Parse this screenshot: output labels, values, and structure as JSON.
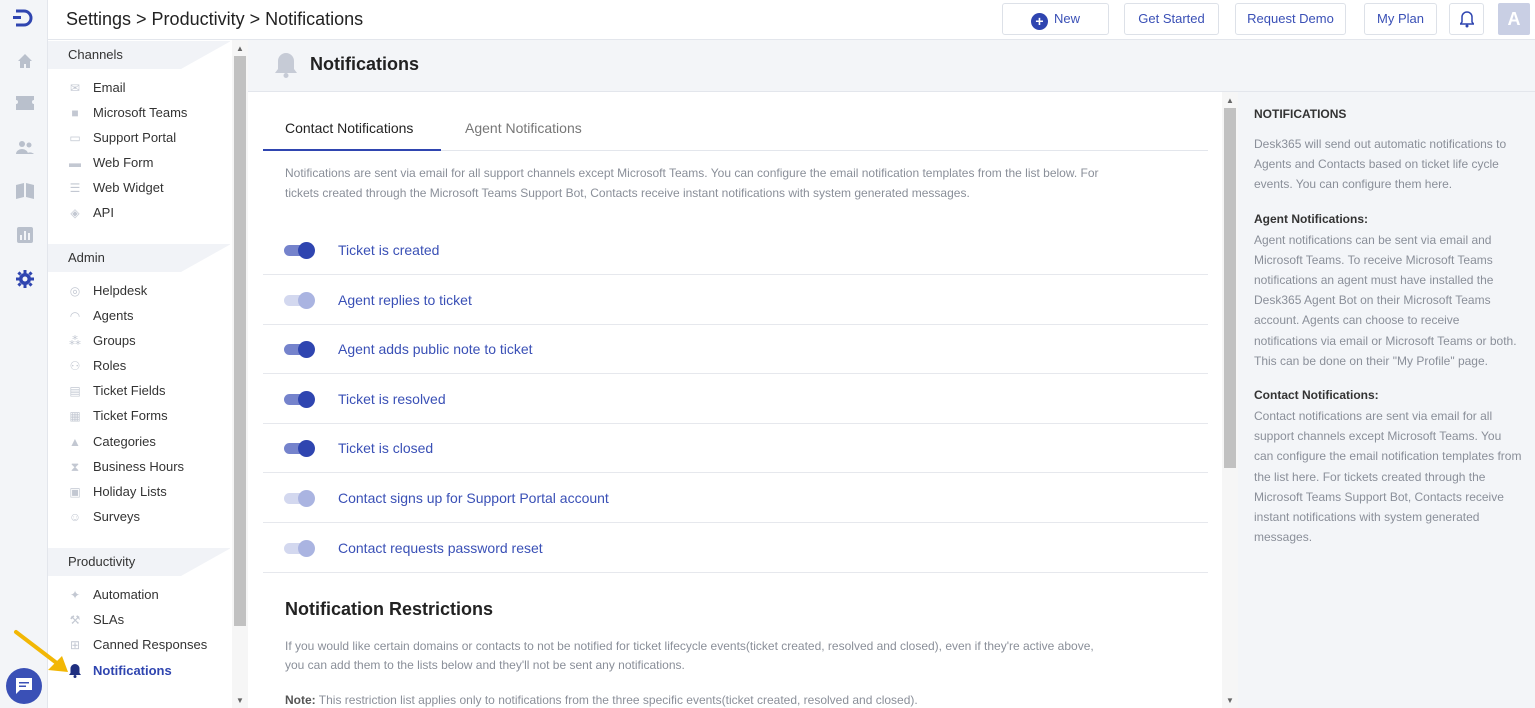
{
  "header": {
    "breadcrumb": "Settings > Productivity > Notifications",
    "new_label": "New",
    "get_started_label": "Get Started",
    "request_demo_label": "Request Demo",
    "my_plan_label": "My Plan",
    "avatar_letter": "A"
  },
  "sidebar": {
    "sections": [
      {
        "title": "Channels",
        "items": [
          "Email",
          "Microsoft Teams",
          "Support Portal",
          "Web Form",
          "Web Widget",
          "API"
        ]
      },
      {
        "title": "Admin",
        "items": [
          "Helpdesk",
          "Agents",
          "Groups",
          "Roles",
          "Ticket Fields",
          "Ticket Forms",
          "Categories",
          "Business Hours",
          "Holiday Lists",
          "Surveys"
        ]
      },
      {
        "title": "Productivity",
        "items": [
          "Automation",
          "SLAs",
          "Canned Responses",
          "Notifications"
        ]
      }
    ],
    "active_item": "Notifications"
  },
  "page": {
    "title": "Notifications",
    "tabs": [
      {
        "label": "Contact Notifications",
        "active": true
      },
      {
        "label": "Agent Notifications",
        "active": false
      }
    ],
    "description": "Notifications are sent via email for all support channels except Microsoft Teams. You can configure the email notification templates from the list below. For tickets created through the Microsoft Teams Support Bot, Contacts receive instant notifications with system generated messages.",
    "notifications": [
      {
        "label": "Ticket is created",
        "enabled": true
      },
      {
        "label": "Agent replies to ticket",
        "enabled": false
      },
      {
        "label": "Agent adds public note to ticket",
        "enabled": true
      },
      {
        "label": "Ticket is resolved",
        "enabled": true
      },
      {
        "label": "Ticket is closed",
        "enabled": true
      },
      {
        "label": "Contact signs up for Support Portal account",
        "enabled": false
      },
      {
        "label": "Contact requests password reset",
        "enabled": false
      }
    ],
    "restrictions": {
      "title": "Notification Restrictions",
      "description": "If you would like certain domains or contacts to not be notified for ticket lifecycle events(ticket created, resolved and closed), even if they're active above, you can add them to the lists below and they'll not be sent any notifications.",
      "note_label": "Note:",
      "note_text": " This restriction list applies only to notifications from the three specific events(ticket created, resolved and closed)."
    }
  },
  "help": {
    "heading": "NOTIFICATIONS",
    "intro": "Desk365 will send out automatic notifications to Agents and Contacts based on ticket life cycle events. You can configure them here.",
    "agent_heading": "Agent Notifications:",
    "agent_text": "Agent notifications can be sent via email and Microsoft Teams. To receive Microsoft Teams notifications an agent must have installed the Desk365 Agent Bot on their Microsoft Teams account. Agents can choose to receive notifications via email or Microsoft Teams or both. This can be done on their \"My Profile\" page.",
    "contact_heading": "Contact Notifications:",
    "contact_text": "Contact notifications are sent via email for all support channels except Microsoft Teams. You can configure the email notification templates from the list here. For tickets created through the Microsoft Teams Support Bot, Contacts receive instant notifications with system generated messages."
  },
  "colors": {
    "accent": "#2f45b0",
    "link": "#3a50b6",
    "toggle_on": "#2f45b0",
    "toggle_off": "#aab4e1",
    "arrow": "#f2b705"
  },
  "icons": {
    "rail": [
      "logo-icon",
      "home-icon",
      "tickets-icon",
      "contacts-icon",
      "knowledge-base-icon",
      "reports-icon",
      "settings-icon",
      "chat-icon"
    ]
  }
}
